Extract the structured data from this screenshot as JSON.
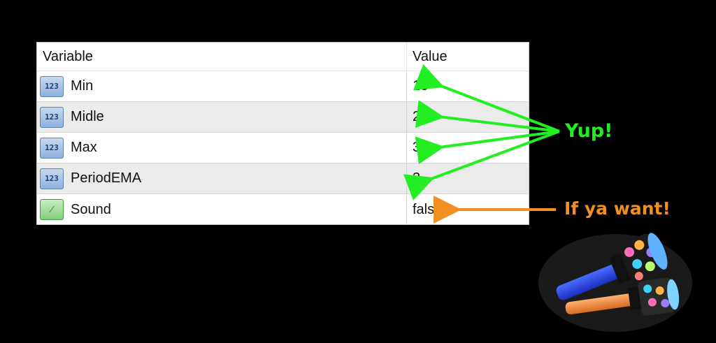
{
  "table": {
    "headers": {
      "variable": "Variable",
      "value": "Value"
    },
    "rows": [
      {
        "icon": "integer-icon",
        "icon_text": "123",
        "name": "Min",
        "value": "13"
      },
      {
        "icon": "integer-icon",
        "icon_text": "123",
        "name": "Midle",
        "value": "21"
      },
      {
        "icon": "integer-icon",
        "icon_text": "123",
        "name": "Max",
        "value": "34"
      },
      {
        "icon": "integer-icon",
        "icon_text": "123",
        "name": "PeriodEMA",
        "value": "3"
      },
      {
        "icon": "boolean-icon",
        "icon_text": "⁄",
        "name": "Sound",
        "value": "false"
      }
    ]
  },
  "annotations": {
    "yup": "Yup!",
    "if_ya_want": "If ya want!"
  },
  "colors": {
    "yup_arrow": "#22ee22",
    "want_arrow": "#f09020"
  }
}
